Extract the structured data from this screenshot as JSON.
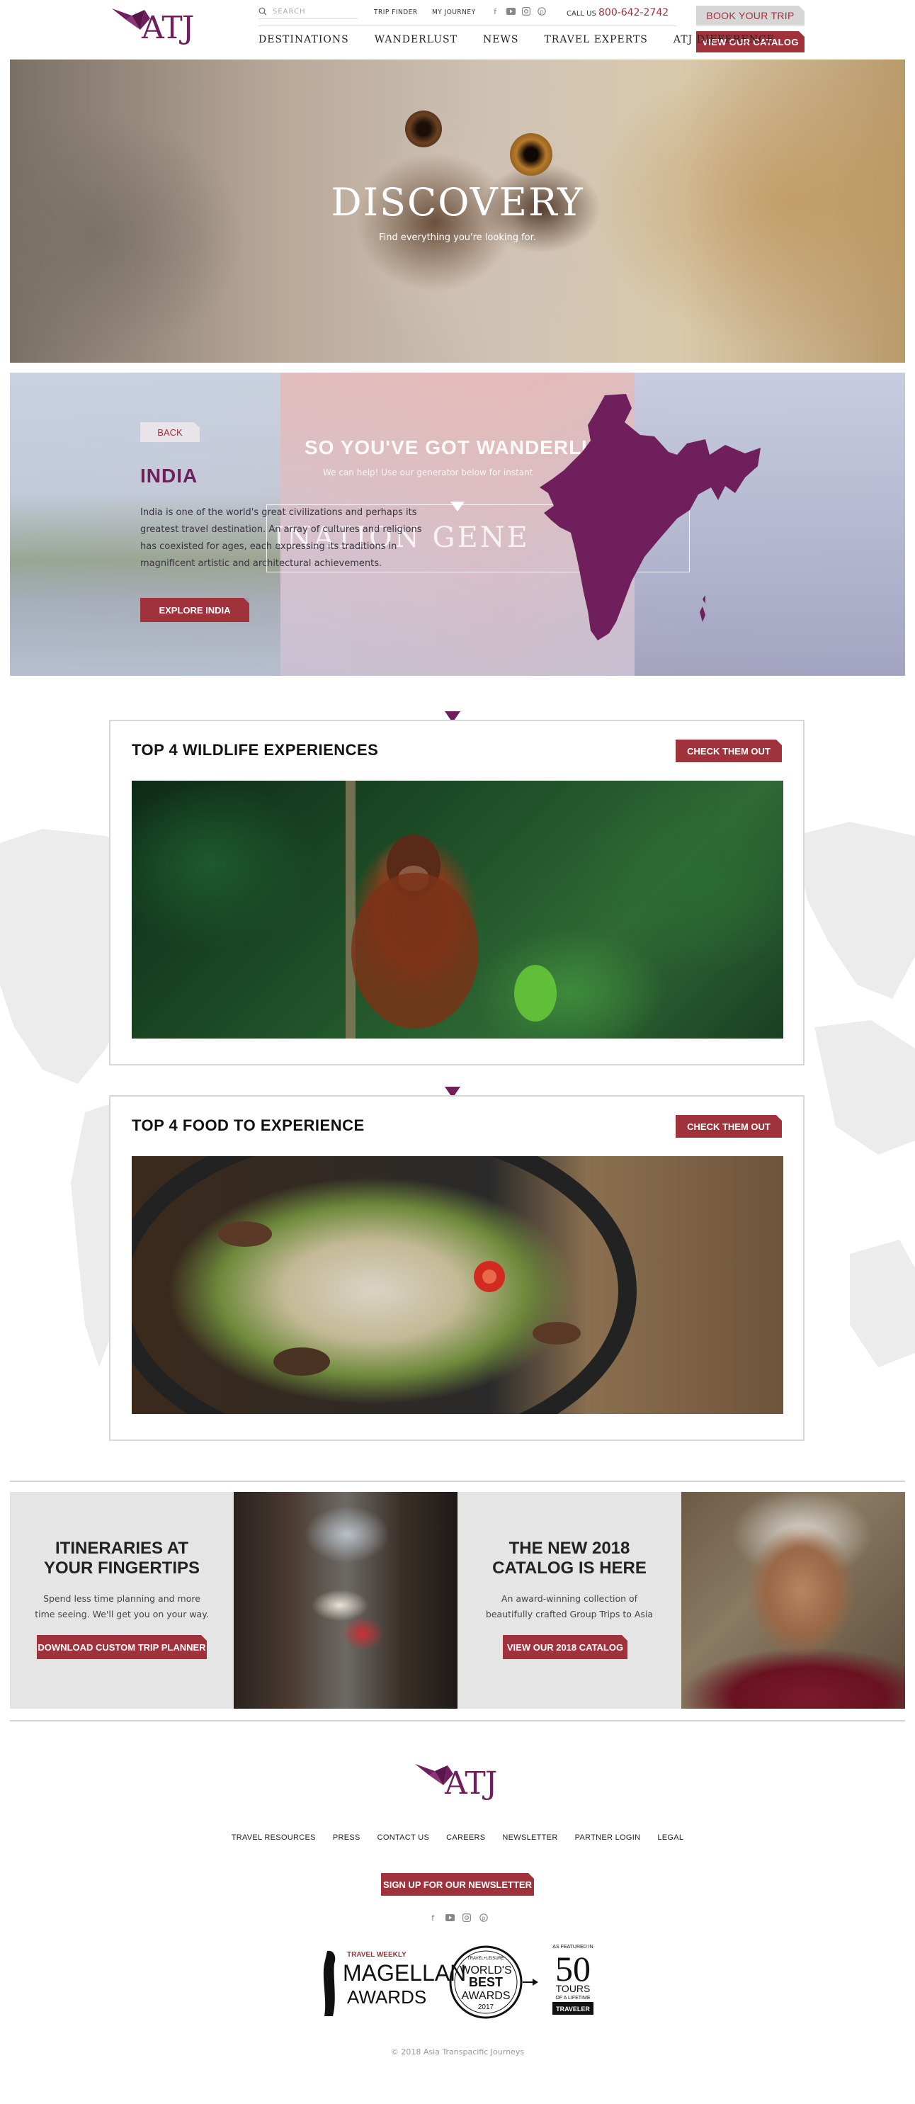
{
  "header": {
    "logo_text": "ATJ",
    "search_placeholder": "SEARCH",
    "top_links": [
      "TRIP FINDER",
      "MY JOURNEY"
    ],
    "social_icons": [
      "facebook-icon",
      "youtube-icon",
      "instagram-icon",
      "pinterest-icon"
    ],
    "call_label": "CALL US",
    "phone": "800-642-2742",
    "book_trip": "BOOK YOUR TRIP",
    "view_catalog": "VIEW OUR CATALOG",
    "nav": [
      "DESTINATIONS",
      "WANDERLUST",
      "NEWS",
      "TRAVEL EXPERTS",
      "ATJ DIFFERENCE"
    ]
  },
  "hero": {
    "title": "DISCOVERY",
    "subtitle": "Find everything you're looking for."
  },
  "generator": {
    "title": "SO YOU'VE GOT WANDERLU",
    "subtitle": "We can help! Use our generator below for instant",
    "box_text": "INATION GENE"
  },
  "india": {
    "back": "BACK",
    "title": "INDIA",
    "body": "India is one of the world's great civilizations and perhaps its greatest travel destination. An array of cultures and religions has coexisted for ages, each expressing its traditions in magnificent artistic and architectural achievements.",
    "explore": "EXPLORE INDIA"
  },
  "cards": [
    {
      "title": "TOP 4 WILDLIFE EXPERIENCES",
      "button": "CHECK THEM OUT"
    },
    {
      "title": "TOP 4 FOOD TO EXPERIENCE",
      "button": "CHECK THEM OUT"
    }
  ],
  "promos": [
    {
      "title_line1": "ITINERARIES AT",
      "title_line2": "YOUR FINGERTIPS",
      "body_line1": "Spend less time planning and more",
      "body_line2": "time seeing. We'll get you on your way.",
      "button": "DOWNLOAD CUSTOM TRIP PLANNER"
    },
    {
      "title_line1": "THE NEW 2018",
      "title_line2": "CATALOG IS HERE",
      "body_line1": "An award-winning collection of",
      "body_line2": "beautifully crafted Group Trips to Asia",
      "button": "VIEW OUR 2018 CATALOG"
    }
  ],
  "footer": {
    "logo_text": "ATJ",
    "links": [
      "TRAVEL RESOURCES",
      "PRESS",
      "CONTACT US",
      "CAREERS",
      "NEWSLETTER",
      "PARTNER LOGIN",
      "LEGAL"
    ],
    "newsletter": "SIGN UP FOR OUR NEWSLETTER",
    "social_icons": [
      "facebook-icon",
      "youtube-icon",
      "instagram-icon",
      "pinterest-icon"
    ],
    "awards": {
      "magellan_top": "TRAVEL WEEKLY",
      "magellan_1": "MAGELLAN",
      "magellan_2": "AWARDS",
      "wba_top": "TRAVEL+LEISURE",
      "wba_1": "WORLD'S",
      "wba_2": "BEST",
      "wba_3": "AWARDS",
      "wba_year": "2017",
      "tours_top": "AS FEATURED IN",
      "tours_num": "50",
      "tours_1": "TOURS",
      "tours_2": "OF A LIFETIME",
      "tours_brand": "TRAVELER"
    },
    "copyright": "© 2018 Asia Transpacific Journeys"
  },
  "colors": {
    "brand_purple": "#6e1f5c",
    "brand_red": "#a0323c"
  }
}
